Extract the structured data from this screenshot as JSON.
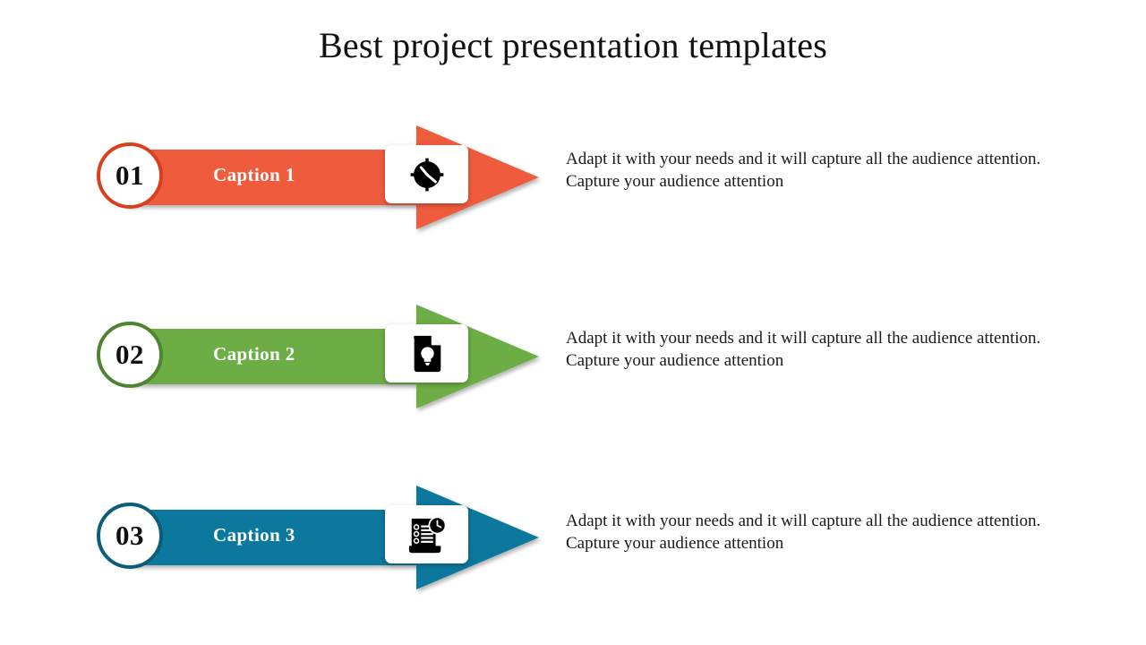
{
  "slide": {
    "title": "Best project presentation templates",
    "background_color": "#ffffff"
  },
  "rows": [
    {
      "number": "01",
      "caption": "Caption 1",
      "description": "Adapt it with your needs and it will capture all the audience attention. Capture your audience attention",
      "arrow_color": "#EF5B3D",
      "circle_border_color": "#D8401E",
      "icon": "clock-icon"
    },
    {
      "number": "02",
      "caption": "Caption 2",
      "description": "Adapt it with your needs and it will capture all the audience attention. Capture your audience attention",
      "arrow_color": "#6CAE44",
      "circle_border_color": "#4E8431",
      "icon": "document-lightbulb-icon"
    },
    {
      "number": "03",
      "caption": "Caption 3",
      "description": "Adapt it with your needs and it will capture all the audience attention. Capture your audience attention",
      "arrow_color": "#11789D",
      "circle_border_color": "#0C5D79",
      "icon": "checklist-clock-icon"
    }
  ]
}
